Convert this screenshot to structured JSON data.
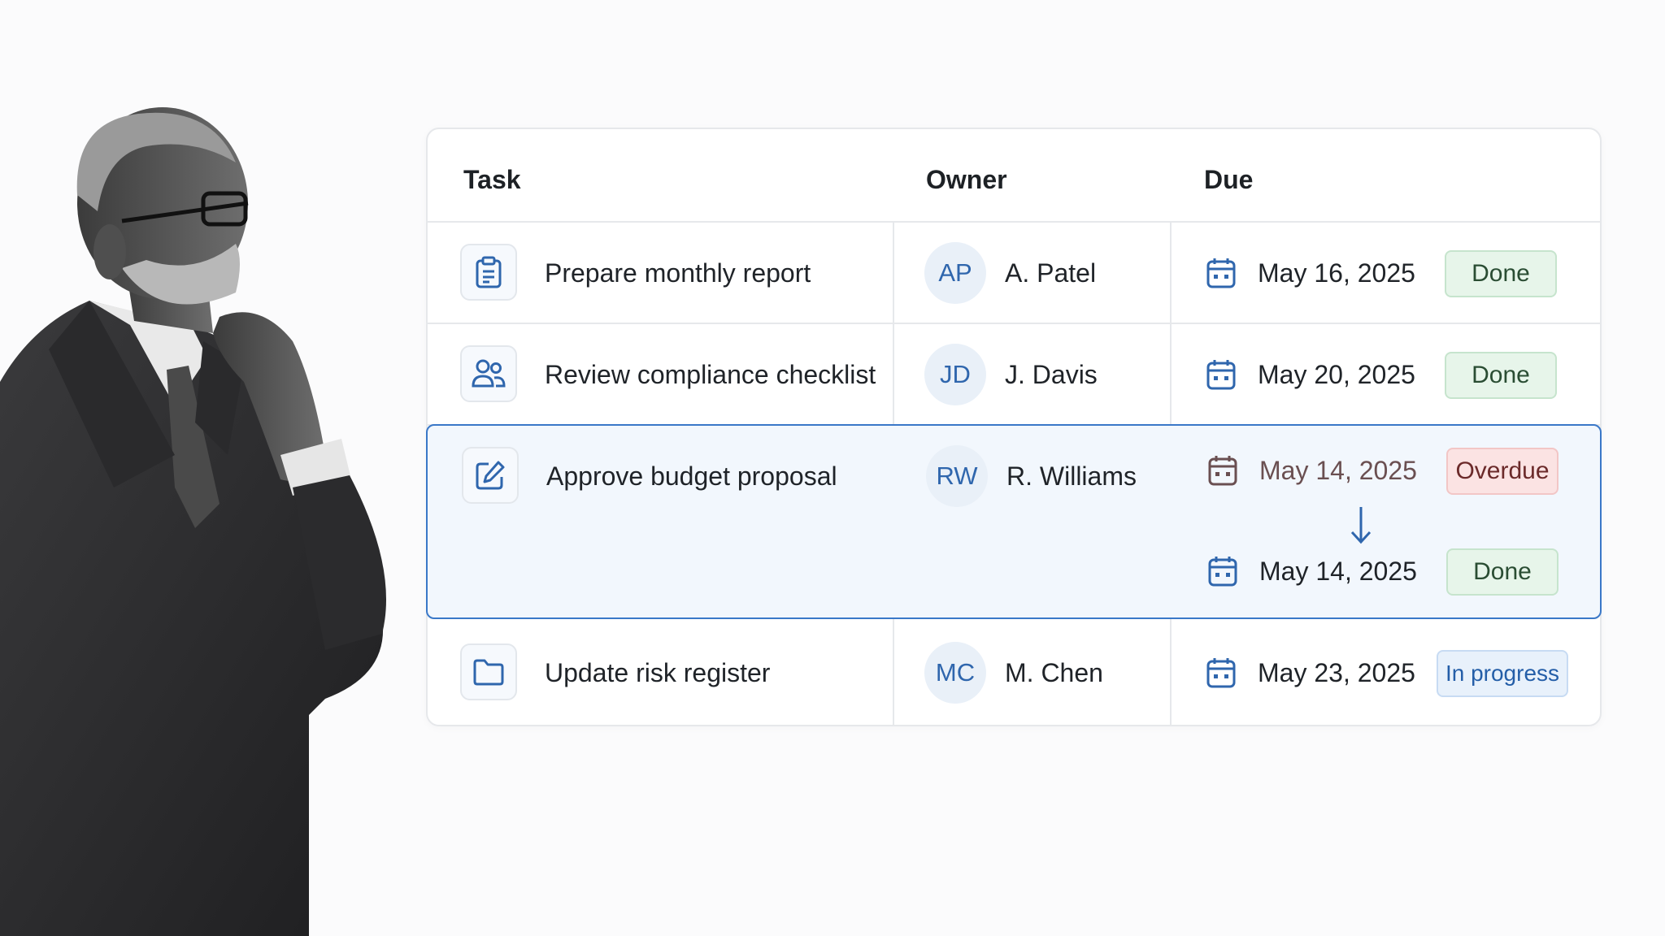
{
  "colors": {
    "accent": "#3a78c8",
    "done": "#e7f5ea",
    "overdue": "#fbe3e3",
    "in_progress": "#e8f1fb"
  },
  "table": {
    "headers": {
      "task": "Task",
      "owner": "Owner",
      "due": "Due"
    },
    "rows": [
      {
        "icon": "clipboard-icon",
        "task": "Prepare monthly report",
        "initials": "AP",
        "owner": "A. Patel",
        "date": "May 16, 2025",
        "status": "Done"
      },
      {
        "icon": "users-icon",
        "task": "Review compliance checklist",
        "initials": "JD",
        "owner": "J. Davis",
        "date": "May 20, 2025",
        "status": "Done"
      },
      {
        "icon": "edit-icon",
        "task": "Approve budget proposal",
        "initials": "RW",
        "owner": "R. Williams",
        "old_date": "May 14, 2025",
        "old_status": "Overdue",
        "date": "May 14, 2025",
        "status": "Done",
        "selected": true
      },
      {
        "icon": "folder-icon",
        "task": "Update risk register",
        "initials": "MC",
        "owner": "M. Chen",
        "date": "May 23, 2025",
        "status": "In progress"
      }
    ]
  }
}
